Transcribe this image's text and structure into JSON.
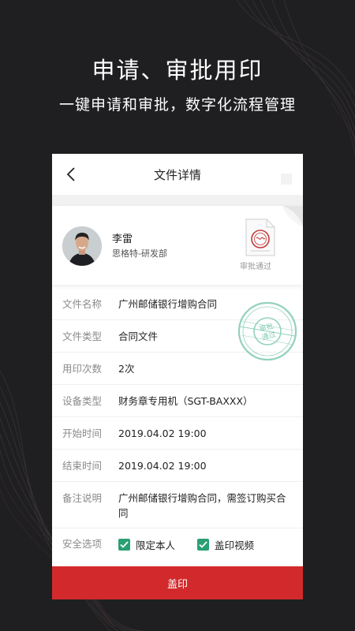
{
  "hero": {
    "headline": "申请、审批用印",
    "subline": "一键申请和审批，数字化流程管理"
  },
  "screen": {
    "nav_title": "文件详情",
    "user": {
      "name": "李雷",
      "dept": "思格特-研发部"
    },
    "doc_status": "审批通过",
    "stamp_text": {
      "line1": "审批",
      "line2": "通过"
    },
    "fields": [
      {
        "label": "文件名称",
        "value": "广州邮储银行增购合同"
      },
      {
        "label": "文件类型",
        "value": "合同文件"
      },
      {
        "label": "用印次数",
        "value": "2次"
      },
      {
        "label": "设备类型",
        "value": "财务章专用机（SGT-BAXXX）"
      },
      {
        "label": "开始时间",
        "value": "2019.04.02 19:00"
      },
      {
        "label": "结束时间",
        "value": "2019.04.02 19:00"
      },
      {
        "label": "备注说明",
        "value": "广州邮储银行增购合同，需签订购买合同"
      }
    ],
    "security": {
      "label": "安全选项",
      "options": [
        "限定本人",
        "盖印视频"
      ]
    },
    "stamp_button": "盖印"
  },
  "colors": {
    "background": "#1f1f21",
    "primary_button": "#d22a2c",
    "checkbox": "#2aa073",
    "stamp_green": "#6fc3a5",
    "stamp_red": "#c33a3a"
  }
}
